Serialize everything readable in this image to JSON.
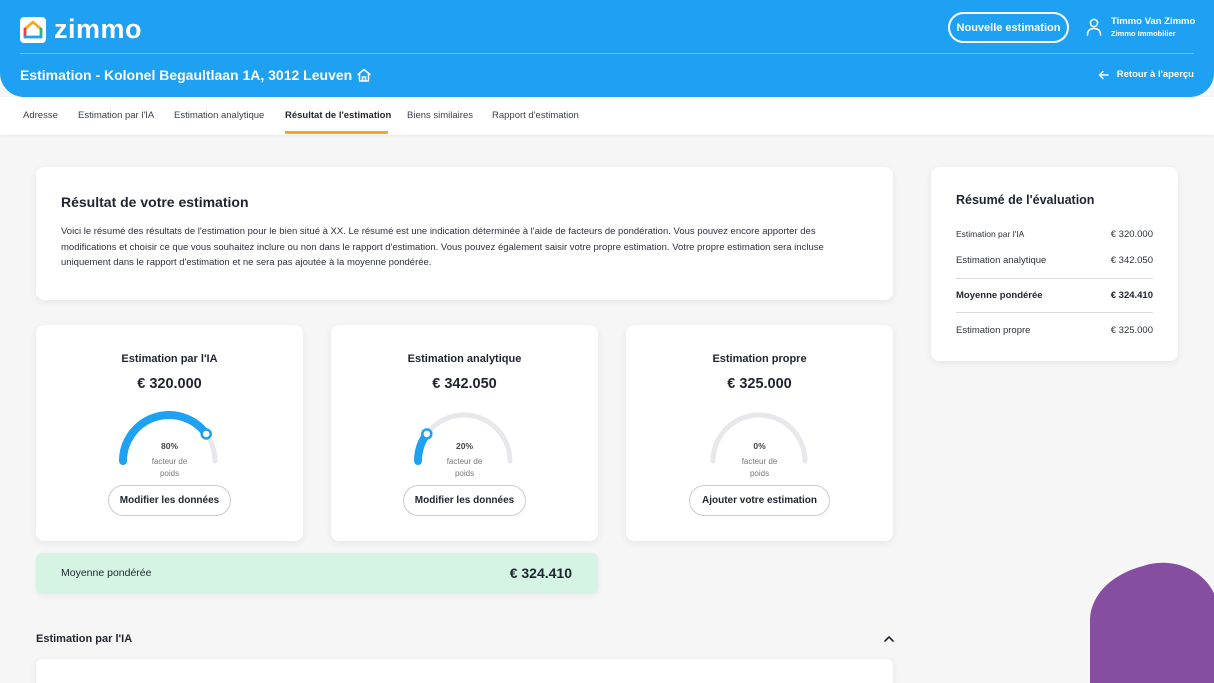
{
  "header": {
    "logo_text": "zimmo",
    "new_estimate_label": "Nouvelle estimation",
    "user_name": "Timmo Van Zimmo",
    "user_company": "Zimmo Immobilier",
    "page_title": "Estimation - Kolonel Begaultlaan 1A, 3012 Leuven",
    "back_label": "Retour à l'aperçu",
    "icons": [
      "home-icon",
      "user-icon",
      "arrow-left-icon"
    ]
  },
  "tabs": [
    {
      "label": "Adresse",
      "active": false
    },
    {
      "label": "Estimation par l'IA",
      "active": false
    },
    {
      "label": "Estimation analytique",
      "active": false
    },
    {
      "label": "Résultat de l'estimation",
      "active": true
    },
    {
      "label": "Biens similaires",
      "active": false
    },
    {
      "label": "Rapport d'estimation",
      "active": false
    }
  ],
  "intro": {
    "title": "Résultat de votre estimation",
    "text": "Voici le résumé des résultats de l'estimation pour le bien situé à XX. Le résumé est une indication déterminée à l'aide de facteurs de pondération. Vous pouvez encore apporter des modifications et choisir ce que vous souhaitez inclure ou non dans le rapport d'estimation. Vous pouvez également saisir votre propre estimation. Votre propre estimation sera incluse uniquement dans le rapport d'estimation et ne sera pas ajoutée à la moyenne pondérée."
  },
  "estimates": [
    {
      "title": "Estimation par l'IA",
      "value": "€ 320.000",
      "percent_label": "80%",
      "weight": 0.8,
      "weight_label": "facteur de poids",
      "button": "Modifier les données"
    },
    {
      "title": "Estimation analytique",
      "value": "€ 342.050",
      "percent_label": "20%",
      "weight": 0.2,
      "weight_label": "facteur de poids",
      "button": "Modifier les données"
    },
    {
      "title": "Estimation propre",
      "value": "€ 325.000",
      "percent_label": "0%",
      "weight": 0,
      "weight_label": "facteur de poids",
      "button": "Ajouter votre estimation"
    }
  ],
  "average": {
    "label": "Moyenne pondérée",
    "value": "€ 324.410"
  },
  "section": {
    "label": "Estimation par l'IA"
  },
  "summary": {
    "title": "Résumé de l'évaluation",
    "rows": [
      {
        "label": "Estimation par l'IA",
        "value": "€ 320.000"
      },
      {
        "label": "Estimation analytique",
        "value": "€ 342.050"
      },
      {
        "label": "Moyenne pondérée",
        "value": "€ 324.410"
      },
      {
        "label": "Estimation propre",
        "value": "€ 325.000"
      }
    ]
  },
  "colors": {
    "primary": "#1ea0f3",
    "accent": "#f5a623",
    "average_bg": "#d6f4e4",
    "gauge_track": "#e6e8ec",
    "blob": "#7b3f98"
  }
}
